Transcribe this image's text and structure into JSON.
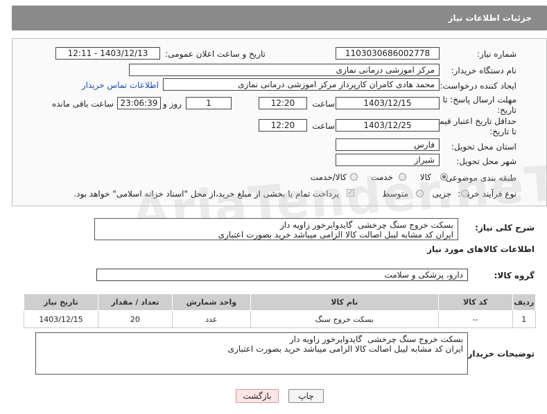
{
  "header": {
    "title": "جزئیات اطلاعات نیاز"
  },
  "fields": {
    "need_number_label": "شماره نیاز:",
    "need_number": "1103030686002778",
    "announce_label": "تاریخ و ساعت اعلان عمومی:",
    "announce_value": "1403/12/13 - 12:11",
    "buyer_org_label": "نام دستگاه خریدار:",
    "buyer_org": "مرکز اموزشی درمانی نمازی",
    "creator_label": "ایجاد کننده درخواست:",
    "creator": "محمد هادی کامران کارپرداز مرکز اموزشی درمانی نمازی",
    "contact_link": "اطلاعات تماس خریدار",
    "deadline_label": "مهلت ارسال پاسخ: تا تاریخ:",
    "deadline_date": "1403/12/15",
    "time_label": "ساعت",
    "deadline_time": "12:20",
    "days_value": "1",
    "days_label": "روز و",
    "remaining_time": "23:06:39",
    "remaining_label": "ساعت باقی مانده",
    "validity_label": "حداقل تاریخ اعتبار قیمت: تا تاریخ:",
    "validity_date": "1403/12/25",
    "validity_time": "12:20",
    "province_label": "استان محل تحویل:",
    "province": "فارس",
    "city_label": "شهر محل تحویل:",
    "city": "شیراز",
    "category_label": "طبقه بندی موضوعی:",
    "category_options": [
      "کالا",
      "خدمت",
      "کالا/خدمت"
    ],
    "process_label": "نوع فرآیند خرید :",
    "process_options": [
      "جزیی",
      "متوسط"
    ],
    "payment_note": "پرداخت تمام یا بخشی از مبلغ خرید،از محل \"اسناد خزانه اسلامی\" خواهد بود."
  },
  "description": {
    "label": "شرح کلی نیاز:",
    "text": "بسکت خروج سنگ چرخشی  گایدوایرخور زاویه دار\nایران کد مشابه لیبل اصالت کالا الزامی میباشد خرید بصورت اعتباری"
  },
  "goods": {
    "section_title": "اطلاعات کالاهای مورد نیاز",
    "group_label": "گروه کالا:",
    "group_value": "دارو، پزشکی و سلامت",
    "columns": [
      "ردیف",
      "کد کالا",
      "نام کالا",
      "واحد شمارش",
      "تعداد / مقدار",
      "تاریخ نیاز"
    ],
    "rows": [
      [
        "1",
        "--",
        "بسکت خروج سنگ",
        "عدد",
        "20",
        "1403/12/15"
      ]
    ]
  },
  "buyer_notes": {
    "label": "توضیحات خریدار:",
    "text": "بسکت خروج سنگ چرخشی  گایدوایرخور زاویه دار\nایران کد مشابه لیبل اصالت کالا الزامی میباشد خرید بصورت اعتباری"
  },
  "buttons": {
    "print": "چاپ",
    "back": "بازگشت"
  },
  "watermark": "AriaTender.neT"
}
